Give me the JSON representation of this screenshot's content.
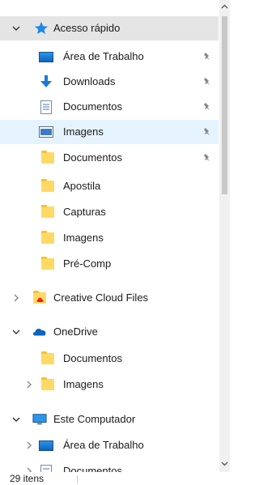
{
  "quick_access": {
    "header": "Acesso rápido",
    "items": [
      {
        "label": "Área de Trabalho",
        "icon": "desktop-icon",
        "pinned": true
      },
      {
        "label": "Downloads",
        "icon": "downloads-icon",
        "pinned": true
      },
      {
        "label": "Documentos",
        "icon": "documents-icon",
        "pinned": true
      },
      {
        "label": "Imagens",
        "icon": "pictures-icon",
        "pinned": true
      },
      {
        "label": "Documentos",
        "icon": "folder-icon",
        "pinned": true
      },
      {
        "label": "Apostila",
        "icon": "folder-icon",
        "pinned": false
      },
      {
        "label": "Capturas",
        "icon": "folder-icon",
        "pinned": false
      },
      {
        "label": "Imagens",
        "icon": "folder-icon",
        "pinned": false
      },
      {
        "label": "Pré-Comp",
        "icon": "folder-icon",
        "pinned": false
      }
    ]
  },
  "creative_cloud": {
    "label": "Creative Cloud Files"
  },
  "onedrive": {
    "label": "OneDrive",
    "items": [
      {
        "label": "Documentos"
      },
      {
        "label": "Imagens"
      }
    ]
  },
  "this_pc": {
    "label": "Este Computador",
    "items": [
      {
        "label": "Área de Trabalho"
      },
      {
        "label": "Documentos"
      }
    ]
  },
  "status": {
    "item_count": "29 itens"
  },
  "colors": {
    "selection": "#cce8ff",
    "hover": "#e5f3ff",
    "folder": "#ffd966",
    "accent": "#0a64c0"
  }
}
